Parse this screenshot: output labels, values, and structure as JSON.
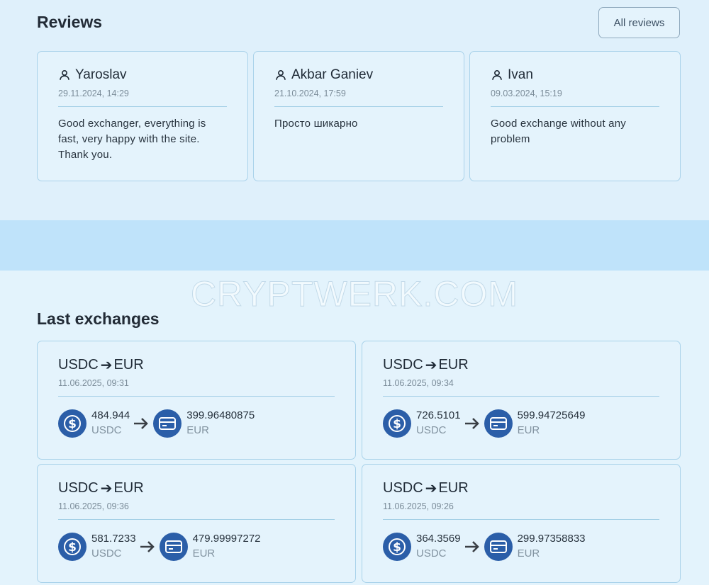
{
  "reviews": {
    "title": "Reviews",
    "all_reviews_label": "All reviews",
    "items": [
      {
        "name": "Yaroslav",
        "date": "29.11.2024, 14:29",
        "text": "Good exchanger, everything is fast, very happy with the site. Thank you."
      },
      {
        "name": "Akbar Ganiev",
        "date": "21.10.2024, 17:59",
        "text": "Просто шикарно"
      },
      {
        "name": "Ivan",
        "date": "09.03.2024, 15:19",
        "text": "Good exchange without any problem"
      }
    ]
  },
  "watermark": "CRYPTWERK.COM",
  "exchanges": {
    "title": "Last exchanges",
    "items": [
      {
        "from": "USDC",
        "to": "EUR",
        "date": "11.06.2025, 09:31",
        "from_amount": "484.944",
        "from_currency": "USDC",
        "to_amount": "399.96480875",
        "to_currency": "EUR"
      },
      {
        "from": "USDC",
        "to": "EUR",
        "date": "11.06.2025, 09:34",
        "from_amount": "726.5101",
        "from_currency": "USDC",
        "to_amount": "599.94725649",
        "to_currency": "EUR"
      },
      {
        "from": "USDC",
        "to": "EUR",
        "date": "11.06.2025, 09:36",
        "from_amount": "581.7233",
        "from_currency": "USDC",
        "to_amount": "479.99997272",
        "to_currency": "EUR"
      },
      {
        "from": "USDC",
        "to": "EUR",
        "date": "11.06.2025, 09:26",
        "from_amount": "364.3569",
        "from_currency": "USDC",
        "to_amount": "299.97358833",
        "to_currency": "EUR"
      }
    ]
  },
  "icons": {
    "user": "user-icon",
    "arrow": "arrow-right-icon",
    "coin": "usdc-coin-icon",
    "card": "credit-card-icon"
  },
  "colors": {
    "accent": "#2b5ea8",
    "card_border": "#a9d2ea",
    "band": "#bfe3fa"
  }
}
